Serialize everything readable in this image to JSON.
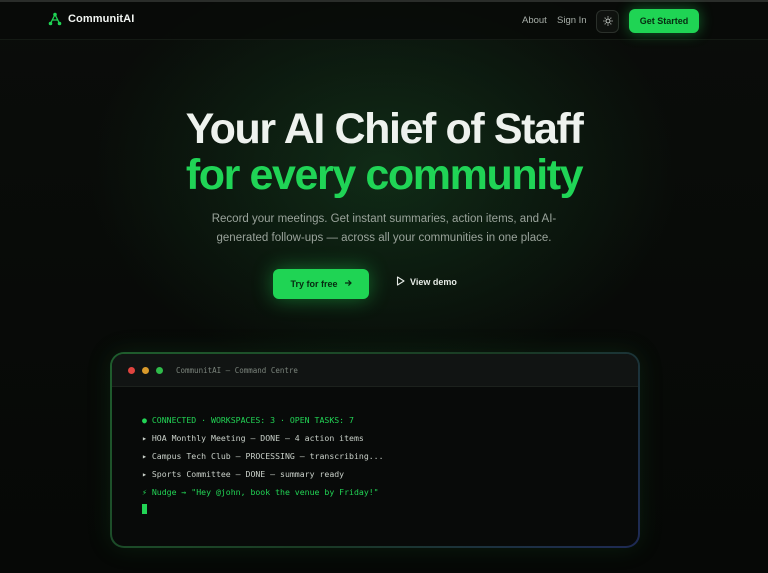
{
  "nav": {
    "brand": "CommunitAI",
    "about": "About",
    "signin": "Sign In",
    "cta": "Get Started"
  },
  "hero": {
    "title_line1": "Your AI Chief of Staff",
    "title_line2": "for every community",
    "subtitle": "Record your meetings. Get instant summaries, action items, and AI-generated follow-ups — across all your communities in one place.",
    "primary_button": "Try for free",
    "secondary_button": "View demo"
  },
  "terminal": {
    "title": "CommunitAI — Command Centre",
    "status_line": "● CONNECTED · WORKSPACES: 3 · OPEN TASKS: 7",
    "lines": [
      "▸ HOA Monthly Meeting — DONE — 4 action items",
      "▸ Campus Tech Club — PROCESSING — transcribing...",
      "▸ Sports Committee — DONE — summary ready"
    ],
    "nudge_line": "⚡ Nudge → \"Hey @john, book the venue by Friday!\""
  },
  "icons": {
    "brand": "network-logo-icon",
    "theme": "sun-icon",
    "try_arrow": "arrow-right-icon",
    "demo": "play-icon"
  },
  "colors": {
    "accent": "#1fd454",
    "background": "#060806",
    "dot_red": "#e0443f",
    "dot_yellow": "#d99a2b",
    "dot_green": "#2fbb4a"
  }
}
